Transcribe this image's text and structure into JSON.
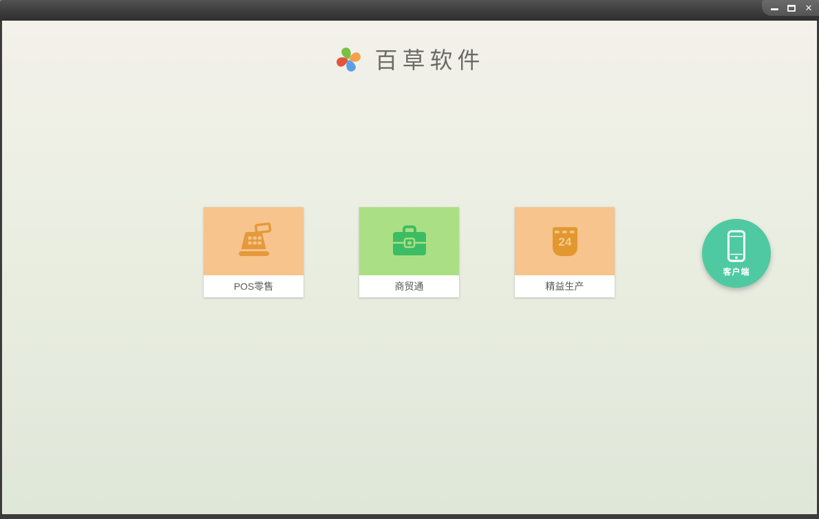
{
  "window": {
    "title_bar": {
      "controls": [
        {
          "name": "minimize",
          "glyph": "—"
        },
        {
          "name": "maximize",
          "glyph": "▢"
        },
        {
          "name": "close",
          "glyph": "✕"
        }
      ]
    }
  },
  "header": {
    "logo_icon": "pinwheel-icon",
    "logo_colors": {
      "top": "#76c043",
      "right": "#f5a14b",
      "bottom": "#5b9fe8",
      "left": "#e2543e"
    },
    "brand_name": "百草软件"
  },
  "products": [
    {
      "label": "POS零售",
      "icon": "cash-register-icon",
      "tile_color": "#f6c48c",
      "icon_color": "#e5993a"
    },
    {
      "label": "商贸通",
      "icon": "briefcase-icon",
      "tile_color": "#abdf85",
      "icon_color": "#3cbd63"
    },
    {
      "label": "精益生产",
      "icon": "calendar-icon",
      "icon_text": "24",
      "tile_color": "#f6c48c",
      "icon_color": "#e2982f"
    }
  ],
  "client_launcher": {
    "label": "客户端",
    "icon": "smartphone-icon",
    "color": "#4fc9a1"
  },
  "colors": {
    "titlebar_top": "#525252",
    "titlebar_bottom": "#2e2e2e",
    "frame": "#3b3b3b",
    "background_top": "#f3f1ea",
    "background_bottom": "#dfe7d9",
    "card_label_text": "#55585a"
  }
}
